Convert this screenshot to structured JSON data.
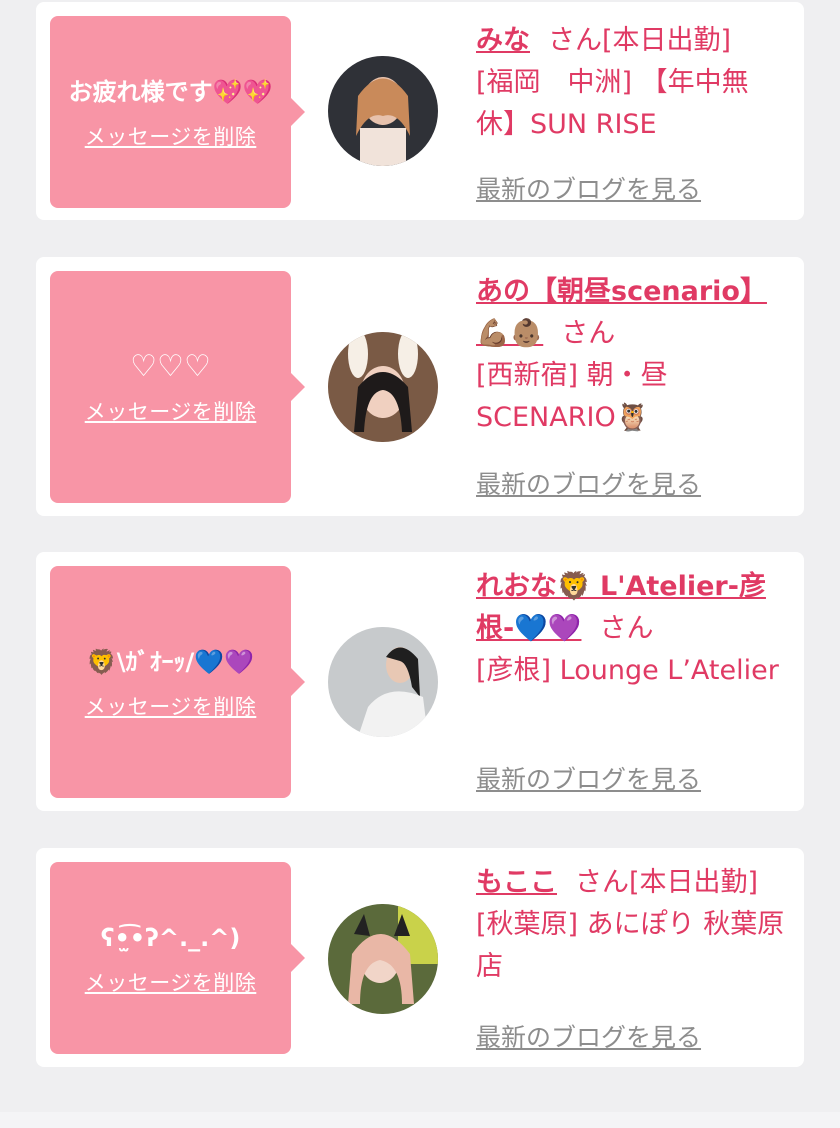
{
  "messages": [
    {
      "message": "お疲れ様です💖💖",
      "delete_label": "メッセージを削除",
      "name": "みな",
      "suffix": "さん[本日出勤]",
      "shop": "[福岡　中洲] 【年中無休】SUN RISE",
      "blog_label": "最新のブログを見る",
      "avatar_color": "#3a3d44"
    },
    {
      "message": "♡♡♡",
      "delete_label": "メッセージを削除",
      "name": "あの【朝昼scenario】💪🏽👶🏽",
      "suffix": "さん",
      "shop": "[西新宿] 朝・昼SCENARIO🦉",
      "blog_label": "最新のブログを見る",
      "avatar_color": "#6b4a3a"
    },
    {
      "message": "🦁\\ｶﾞｵｰｯ/💙💜",
      "delete_label": "メッセージを削除",
      "name": "れおな🦁 L'Atelier-彦根-💙💜",
      "suffix": "さん",
      "shop": "[彦根] Lounge L’Atelier",
      "blog_label": "最新のブログを見る",
      "avatar_color": "#b9bcbe"
    },
    {
      "message": "ʕ•̫͡•ʔ^._.^)",
      "delete_label": "メッセージを削除",
      "name": "もここ",
      "suffix": "さん[本日出勤]",
      "shop": "[秋葉原] あにぽり 秋葉原店",
      "blog_label": "最新のブログを見る",
      "avatar_color": "#4a5a3a"
    }
  ],
  "colors": {
    "accent": "#e03a64",
    "bubble": "#f895a6",
    "link_gray": "#8d8d8d"
  }
}
